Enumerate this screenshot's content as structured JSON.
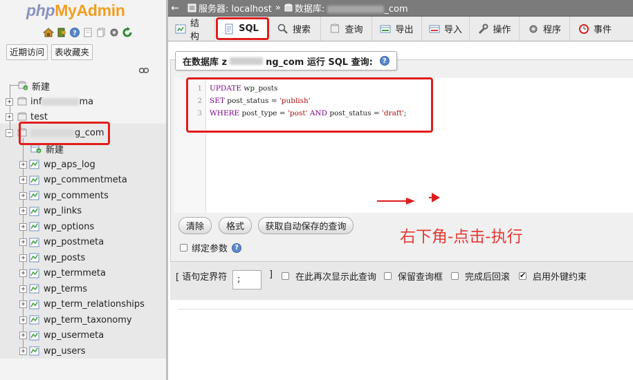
{
  "logo": {
    "php": "php",
    "myadmin": "MyAdmin"
  },
  "left_nav": {
    "buttons": [
      "近期访问",
      "表收藏夹"
    ],
    "tree": [
      {
        "label": "新建",
        "level": 0
      },
      {
        "label_prefix": "inf",
        "label_suffix": "ma",
        "level": 0
      },
      {
        "label": "test",
        "level": 0
      },
      {
        "label_suffix": "g_com",
        "level": 0
      },
      {
        "label": "新建",
        "level": 1
      },
      {
        "label": "wp_aps_log",
        "level": 1
      },
      {
        "label": "wp_commentmeta",
        "level": 1
      },
      {
        "label": "wp_comments",
        "level": 1
      },
      {
        "label": "wp_links",
        "level": 1
      },
      {
        "label": "wp_options",
        "level": 1
      },
      {
        "label": "wp_postmeta",
        "level": 1
      },
      {
        "label": "wp_posts",
        "level": 1
      },
      {
        "label": "wp_termmeta",
        "level": 1
      },
      {
        "label": "wp_terms",
        "level": 1
      },
      {
        "label": "wp_term_relationships",
        "level": 1
      },
      {
        "label": "wp_term_taxonomy",
        "level": 1
      },
      {
        "label": "wp_usermeta",
        "level": 1
      },
      {
        "label": "wp_users",
        "level": 1
      }
    ]
  },
  "topbar": {
    "server_label": "服务器: localhost",
    "separator": "»",
    "db_label": "数据库: ",
    "db_suffix": "_com"
  },
  "tabs": [
    {
      "label": "结构",
      "icon": "structure-icon"
    },
    {
      "label": "SQL",
      "icon": "sql-icon",
      "active": true
    },
    {
      "label": "搜索",
      "icon": "search-icon"
    },
    {
      "label": "查询",
      "icon": "query-icon"
    },
    {
      "label": "导出",
      "icon": "export-icon"
    },
    {
      "label": "导入",
      "icon": "import-icon"
    },
    {
      "label": "操作",
      "icon": "wrench-icon"
    },
    {
      "label": "程序",
      "icon": "routines-icon"
    },
    {
      "label": "事件",
      "icon": "events-icon"
    }
  ],
  "sql_panel": {
    "legend_prefix": "在数据库 z",
    "legend_suffix": "ng_com 运行 SQL 查询:",
    "lines": [
      {
        "num": "1",
        "code": "UPDATE wp_posts"
      },
      {
        "num": "2",
        "code": "SET post_status = 'publish'"
      },
      {
        "num": "3",
        "code": "WHERE post_type = 'post' AND post_status = 'draft';"
      }
    ],
    "buttons": [
      "清除",
      "格式",
      "获取自动保存的查询"
    ],
    "bind_params": "绑定参数"
  },
  "annotation": "右下角-点击-执行",
  "options": {
    "delimiter_label": "[ 语句定界符",
    "delimiter_value": ";",
    "delimiter_close": "]",
    "checkboxes": [
      {
        "label": "在此再次显示此查询",
        "checked": false
      },
      {
        "label": "保留查询框",
        "checked": false
      },
      {
        "label": "完成后回滚",
        "checked": false
      },
      {
        "label": "启用外键约束",
        "checked": true
      }
    ]
  },
  "colors": {
    "highlight": "#e11b1b",
    "annotation": "#e53935",
    "logo_php": "#8892bf",
    "logo_admin": "#f29e1f"
  }
}
